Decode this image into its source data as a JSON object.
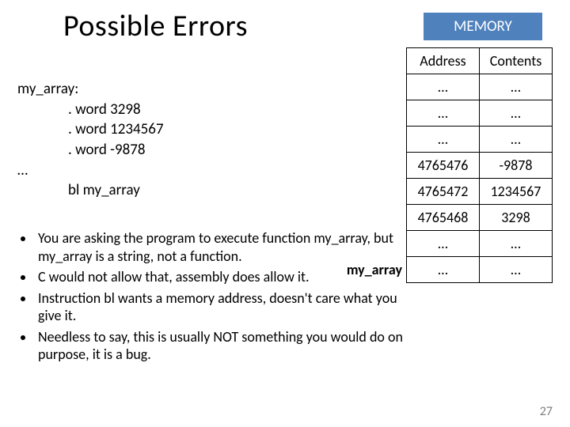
{
  "title": "Possible Errors",
  "memory_badge": "MEMORY",
  "table": {
    "headers": {
      "addr": "Address",
      "cont": "Contents"
    },
    "rows": [
      {
        "addr": "…",
        "cont": "…"
      },
      {
        "addr": "…",
        "cont": "…"
      },
      {
        "addr": "…",
        "cont": "…"
      },
      {
        "addr": "4765476",
        "cont": "-9878"
      },
      {
        "addr": "4765472",
        "cont": "1234567"
      },
      {
        "addr": "4765468",
        "cont": "3298"
      },
      {
        "addr": "…",
        "cont": "…"
      },
      {
        "addr": "…",
        "cont": "…"
      }
    ]
  },
  "code": {
    "l0": "my_array:",
    "l1": ". word 3298",
    "l2": ". word 1234567",
    "l3": ". word -9878",
    "l4": "…",
    "l5": "bl my_array"
  },
  "bullets": {
    "b0": "You are asking the program to execute function my_array, but my_array is a string, not a function.",
    "b1": "C would not allow that, assembly does allow it.",
    "b2": "Instruction bl wants a memory address, doesn't care what you give it.",
    "b3": "Needless to say, this is usually NOT something you would do on purpose, it is a bug."
  },
  "row_label": "my_array",
  "page_number": "27"
}
